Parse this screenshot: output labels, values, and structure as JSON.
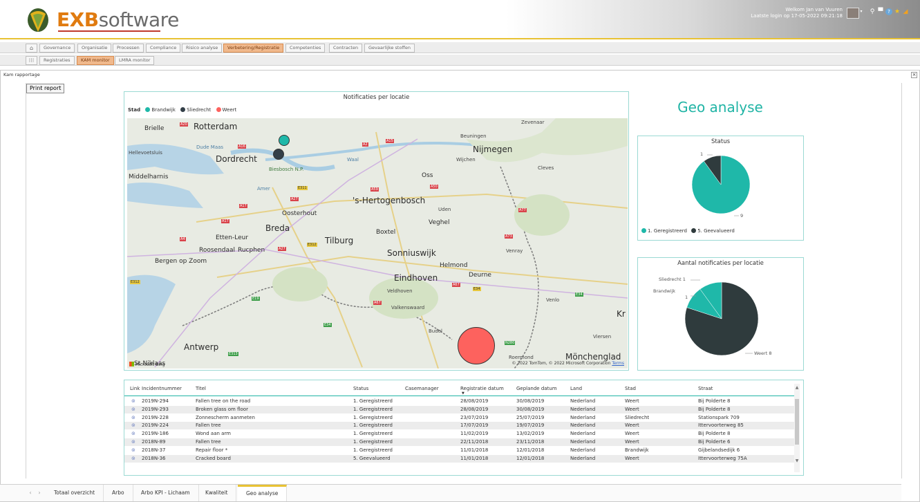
{
  "header": {
    "logo_exb": "EXB",
    "logo_software": "software",
    "welcome": "Welkom Jan van Vuuren",
    "last_login": "Laatste login op 17-05-2022 09:21:18",
    "icons": [
      "search-icon",
      "chat-icon",
      "help-icon",
      "star-icon",
      "bookmark-icon"
    ]
  },
  "tabs1": [
    "Governance",
    "Organisatie",
    "Processen",
    "Compliance",
    "Risico analyse",
    "Verbetering/Registratie",
    "Competenties",
    "Contracten",
    "Gevaarlijke stoffen"
  ],
  "tabs2": [
    "Registraties",
    "KAM monitor",
    "LMRA monitor"
  ],
  "panel": {
    "title": "Kam rapportage",
    "print_label": "Print report"
  },
  "map": {
    "title": "Notificaties per locatie",
    "legend_title": "Stad",
    "legend": [
      "Brandwijk",
      "Sliedrecht",
      "Weert"
    ],
    "places": [
      "Brielle",
      "Rotterdam",
      "Hellevoetsluis",
      "Dude Maas",
      "Dordrecht",
      "Biesbosch N.P.",
      "Middelharnis",
      "Amer",
      "Oosterhout",
      "'s-Hertogenbosch",
      "Oss",
      "Nijmegen",
      "Beuningen",
      "Wijchen",
      "Zevenaar",
      "Cleves",
      "Uden",
      "Veghel",
      "Boxtel",
      "Breda",
      "Etten-Leur",
      "Roosendaal",
      "Rucphen",
      "Tilburg",
      "Bergen op Zoom",
      "Sonniuswijk",
      "Helmond",
      "Deurne",
      "Venray",
      "Eindhoven",
      "Veldhoven",
      "Valkenswaard",
      "Venlo",
      "Budel",
      "Antwerp",
      "St-Niklaas",
      "Viersen",
      "Roermond",
      "Mönchenglad",
      "Kr",
      "Waal"
    ],
    "bing": "Microsoft Bing",
    "copyright": "© 2022 TomTom, © 2022 Microsoft Corporation",
    "terms": "Terms",
    "colors": {
      "brandwijk": "#1fb8a9",
      "sliedrecht": "#333f48",
      "weert": "#fd625e"
    }
  },
  "geo_title": "Geo analyse",
  "status_chart": {
    "title": "Status",
    "labels": [
      "1",
      "9"
    ],
    "legend": [
      "1. Geregistreerd",
      "5. Geevalueerd"
    ]
  },
  "loc_chart": {
    "title": "Aantal notificaties per locatie",
    "labels": [
      "Sliedrecht 1",
      "Brandwijk",
      "1",
      "Weert 8"
    ]
  },
  "chart_data": [
    {
      "type": "pie",
      "title": "Status",
      "categories": [
        "1. Geregistreerd",
        "5. Geevalueerd"
      ],
      "values": [
        9,
        1
      ],
      "colors": [
        "#1fb8a9",
        "#2f3b3d"
      ]
    },
    {
      "type": "pie",
      "title": "Aantal notificaties per locatie",
      "categories": [
        "Weert",
        "Brandwijk",
        "Sliedrecht"
      ],
      "values": [
        8,
        1,
        1
      ],
      "colors": [
        "#2f3b3d",
        "#1fb8a9",
        "#1fb8a9"
      ]
    }
  ],
  "table": {
    "headers": [
      "Link",
      "Incidentnummer",
      "Titel",
      "Status",
      "Casemanager",
      "Registratie datum",
      "Geplande datum",
      "Land",
      "Stad",
      "Straat"
    ],
    "rows": [
      [
        "2019N-294",
        "Fallen tree on the road",
        "1. Geregistreerd",
        "",
        "28/08/2019",
        "30/08/2019",
        "Nederland",
        "Weert",
        "Bij Polderte 8"
      ],
      [
        "2019N-293",
        "Broken glass om floor",
        "1. Geregistreerd",
        "",
        "28/08/2019",
        "30/08/2019",
        "Nederland",
        "Weert",
        "Bij Polderte 8"
      ],
      [
        "2019N-228",
        "Zonnescherm aanmeten",
        "1. Geregistreerd",
        "",
        "23/07/2019",
        "25/07/2019",
        "Nederland",
        "Sliedrecht",
        "Stationspark 709"
      ],
      [
        "2019N-224",
        "Fallen tree",
        "1. Geregistreerd",
        "",
        "17/07/2019",
        "19/07/2019",
        "Nederland",
        "Weert",
        "Ittervoorterweg 85"
      ],
      [
        "2019N-186",
        "Wond aan arm",
        "1. Geregistreerd",
        "",
        "11/02/2019",
        "13/02/2019",
        "Nederland",
        "Weert",
        "Bij Polderte 8"
      ],
      [
        "2018N-89",
        "Fallen tree",
        "1. Geregistreerd",
        "",
        "22/11/2018",
        "23/11/2018",
        "Nederland",
        "Weert",
        "Bij Polderte 6"
      ],
      [
        "2018N-37",
        "Repair floor *",
        "1. Geregistreerd",
        "",
        "11/01/2018",
        "12/01/2018",
        "Nederland",
        "Brandwijk",
        "Gijbelandsedijk 6"
      ],
      [
        "2018N-36",
        "Cracked board",
        "5. Geevalueerd",
        "",
        "11/01/2018",
        "12/01/2018",
        "Nederland",
        "Weert",
        "Ittervoorterweg 75A"
      ]
    ]
  },
  "bottom_tabs": [
    "Totaal overzicht",
    "Arbo",
    "Arbo KPI - Lichaam",
    "Kwaliteit",
    "Geo analyse"
  ]
}
